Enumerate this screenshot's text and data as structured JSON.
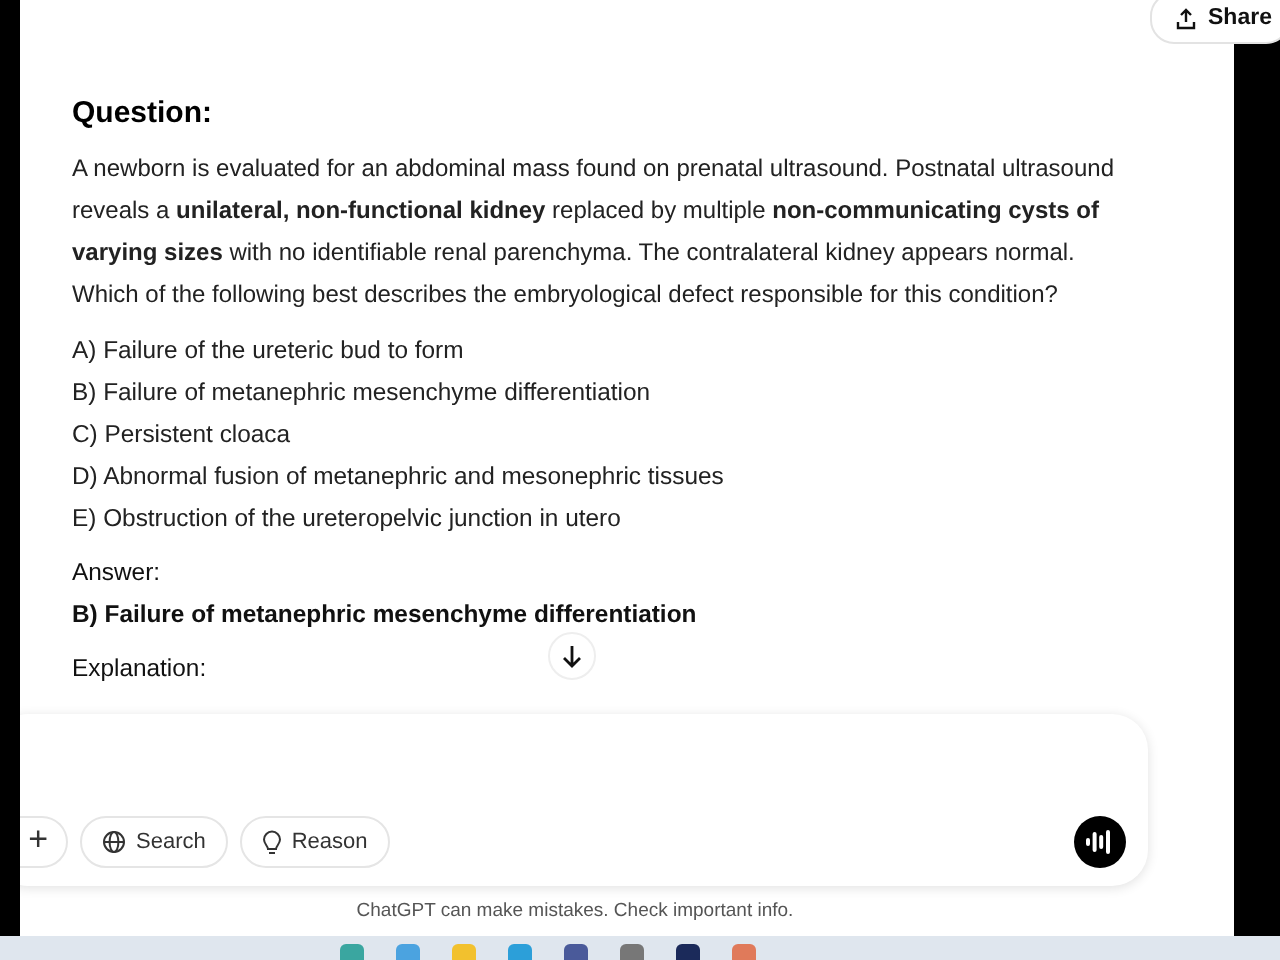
{
  "header": {
    "share": "Share"
  },
  "message": {
    "heading": "Question:",
    "question": "A newborn is evaluated for an abdominal mass found on prenatal ultrasound. Postnatal ultrasound reveals a **unilateral, non-functional kidney** replaced by multiple **non-communicating cysts of varying sizes** with no identifiable renal parenchyma. The contralateral kidney appears normal. Which of the following best describes the embryological defect responsible for this condition?",
    "options": [
      "A) Failure of the ureteric bud to form",
      "B) Failure of metanephric mesenchyme differentiation",
      "C) Persistent cloaca",
      "D) Abnormal fusion of metanephric and mesonephric tissues",
      "E) Obstruction of the ureteropelvic junction in utero"
    ],
    "answer_label": "Answer:",
    "answer": "B) Failure of metanephric mesenchyme differentiation",
    "explanation_label": "Explanation:"
  },
  "composer": {
    "tools": [
      {
        "kind": "add",
        "label": "+"
      },
      {
        "kind": "search",
        "label": "Search"
      },
      {
        "kind": "reason",
        "label": "Reason"
      }
    ]
  },
  "disclaimer": "ChatGPT can make mistakes. Check important info."
}
